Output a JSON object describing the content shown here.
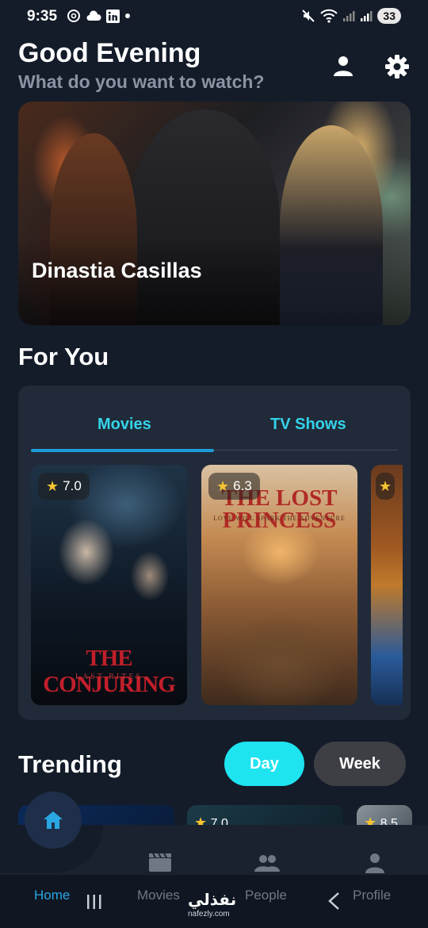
{
  "status_bar": {
    "time": "9:35",
    "left_icons": [
      "threads-icon",
      "cloud-icon",
      "linkedin-icon",
      "dot-icon"
    ],
    "right_icons": [
      "mute-icon",
      "wifi-icon",
      "signal-icon",
      "signal-icon-2"
    ],
    "battery": "33"
  },
  "header": {
    "greeting": "Good Evening",
    "subtitle": "What do you want to watch?"
  },
  "hero": {
    "title": "Dinastia Casillas"
  },
  "for_you": {
    "title": "For You",
    "tabs": [
      {
        "label": "Movies",
        "active": true
      },
      {
        "label": "TV Shows",
        "active": false
      }
    ],
    "posters": [
      {
        "rating": "7.0",
        "title": "THE CONJURING",
        "subtitle": "LAST RITES"
      },
      {
        "rating": "6.3",
        "title": "THE LOST PRINCESS",
        "tagline": "LOVE WILL SPARK THE ADVENTURE"
      },
      {
        "rating": ""
      }
    ]
  },
  "trending": {
    "title": "Trending",
    "toggle": {
      "day": "Day",
      "week": "Week",
      "active": "Day"
    },
    "cards": [
      {
        "rating": ""
      },
      {
        "rating": "7.0"
      },
      {
        "rating": "8.5"
      }
    ]
  },
  "bottom_nav": {
    "items": [
      {
        "label": "Home",
        "icon": "home-icon",
        "active": true
      },
      {
        "label": "Movies",
        "icon": "clapperboard-icon",
        "active": false
      },
      {
        "label": "People",
        "icon": "people-icon",
        "active": false
      },
      {
        "label": "Profile",
        "icon": "person-icon",
        "active": false
      }
    ]
  },
  "watermark": {
    "main": "نفذلي",
    "sub": "nafezly.com"
  },
  "colors": {
    "background": "#141c29",
    "accent": "#34d3ea",
    "day_button": "#1ee4f0",
    "active_nav": "#2aa7e3",
    "star": "#f7c331"
  }
}
